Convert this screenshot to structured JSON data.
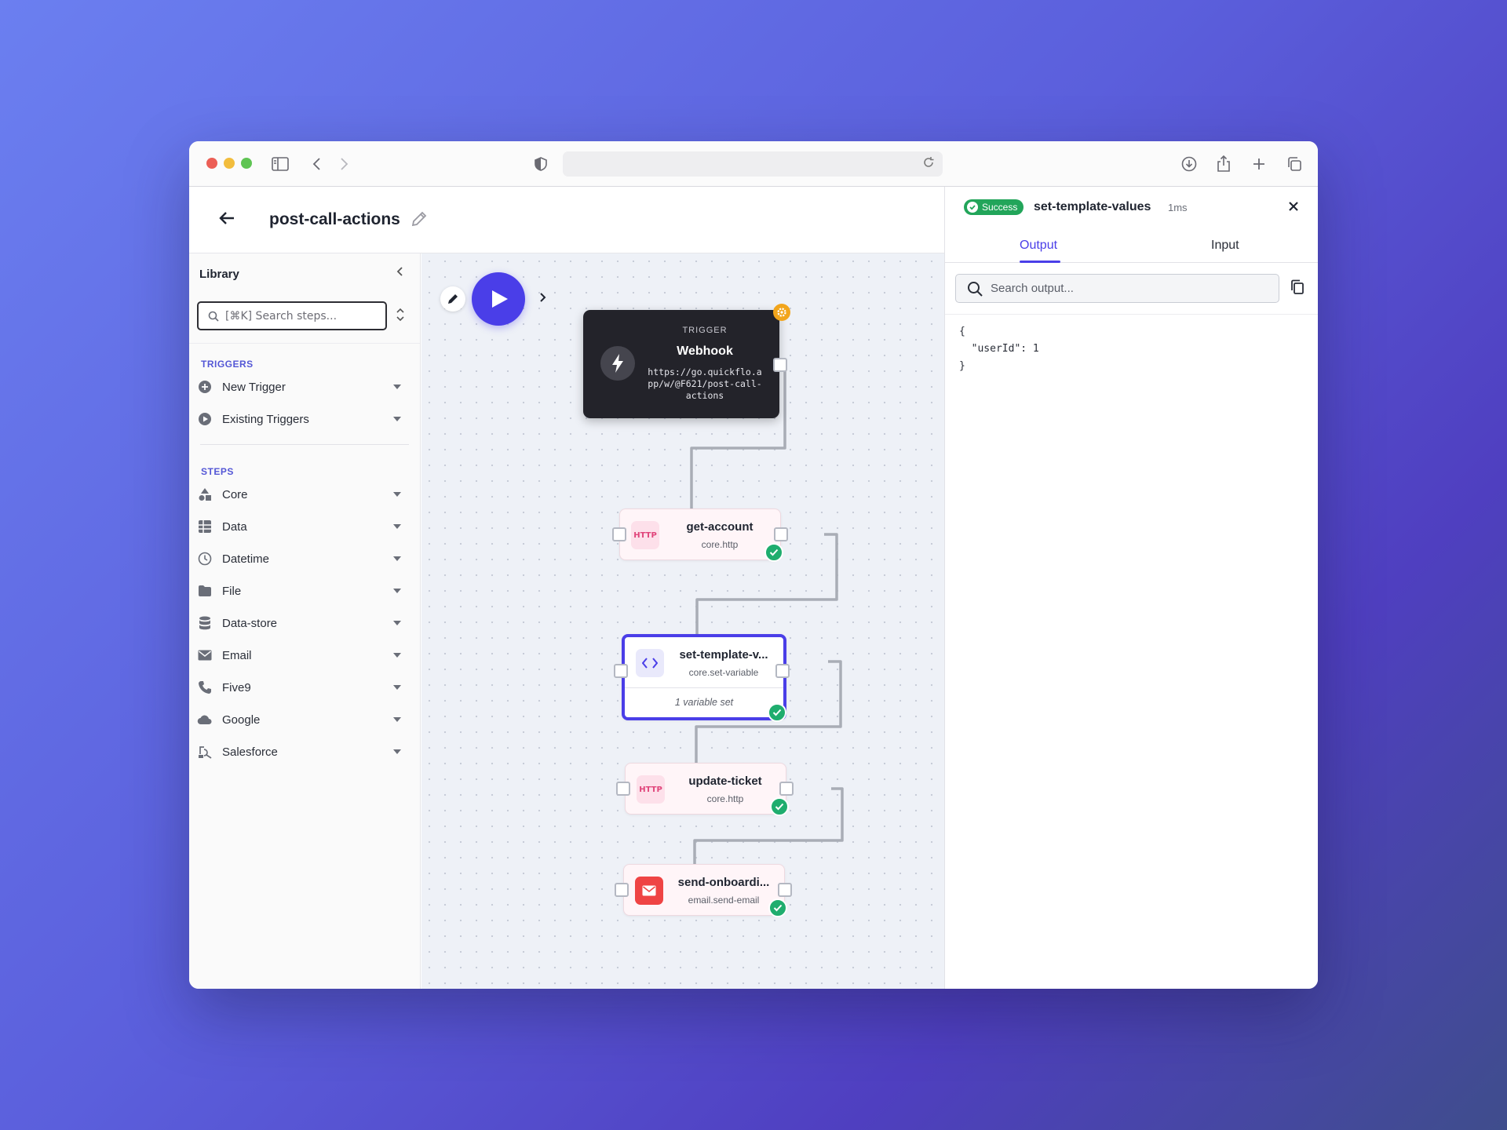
{
  "workflow": {
    "title": "post-call-actions"
  },
  "library": {
    "title": "Library",
    "search_placeholder": "[⌘K] Search steps...",
    "triggers_label": "TRIGGERS",
    "triggers": [
      {
        "label": "New Trigger",
        "icon": "plus-circle-icon"
      },
      {
        "label": "Existing Triggers",
        "icon": "play-circle-icon"
      }
    ],
    "steps_label": "STEPS",
    "steps": [
      {
        "label": "Core",
        "icon": "shapes-icon"
      },
      {
        "label": "Data",
        "icon": "grid-icon"
      },
      {
        "label": "Datetime",
        "icon": "clock-icon"
      },
      {
        "label": "File",
        "icon": "folder-icon"
      },
      {
        "label": "Data-store",
        "icon": "database-icon"
      },
      {
        "label": "Email",
        "icon": "mail-icon"
      },
      {
        "label": "Five9",
        "icon": "phone-icon"
      },
      {
        "label": "Google",
        "icon": "cloud-icon"
      },
      {
        "label": "Salesforce",
        "icon": "salesforce-icon"
      }
    ]
  },
  "canvas": {
    "trigger": {
      "kind": "TRIGGER",
      "name": "Webhook",
      "url": "https://go.quickflo.app/w/@F621/post-call-actions"
    },
    "nodes": [
      {
        "name": "get-account",
        "type": "core.http",
        "icon_text": "HTTP",
        "status": "success"
      },
      {
        "name": "set-template-v...",
        "type": "core.set-variable",
        "note": "1 variable set",
        "status": "success",
        "selected": true
      },
      {
        "name": "update-ticket",
        "type": "core.http",
        "icon_text": "HTTP",
        "status": "success"
      },
      {
        "name": "send-onboardi...",
        "type": "email.send-email",
        "status": "success"
      }
    ]
  },
  "panel": {
    "status": "Success",
    "title": "set-template-values",
    "duration": "1ms",
    "tabs": [
      {
        "label": "Output",
        "active": true
      },
      {
        "label": "Input",
        "active": false
      }
    ],
    "search_placeholder": "Search output...",
    "output": "{\n  \"userId\": 1\n}"
  },
  "colors": {
    "accent": "#4a3ee8",
    "success": "#22a55a",
    "trigger_bg": "#23232a",
    "section_label": "#5457d6"
  }
}
